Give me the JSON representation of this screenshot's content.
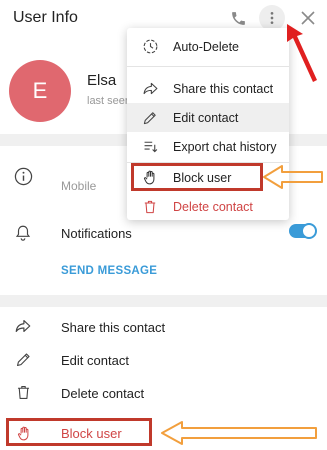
{
  "header": {
    "title": "User Info",
    "icons": [
      "phone-icon",
      "more-vert-icon",
      "close-icon"
    ]
  },
  "profile": {
    "avatar_initial": "E",
    "avatar_color": "#e0686f",
    "name": "Elsa",
    "status": "last seen"
  },
  "info": {
    "mobile_label": "Mobile",
    "notifications_label": "Notifications",
    "notifications_on": true,
    "send_message": "SEND MESSAGE"
  },
  "actions": [
    {
      "label": "Share this contact",
      "icon": "share-icon"
    },
    {
      "label": "Edit contact",
      "icon": "pencil-icon"
    },
    {
      "label": "Delete contact",
      "icon": "trash-icon"
    },
    {
      "label": "Block user",
      "icon": "block-hand-icon"
    }
  ],
  "menu": {
    "items": [
      {
        "label": "Auto-Delete",
        "icon": "timer-icon"
      },
      {
        "label": "Share this contact",
        "icon": "share-icon"
      },
      {
        "label": "Edit contact",
        "icon": "pencil-icon"
      },
      {
        "label": "Export chat history",
        "icon": "export-icon"
      },
      {
        "label": "Block user",
        "icon": "block-hand-icon"
      },
      {
        "label": "Delete contact",
        "icon": "trash-icon"
      }
    ]
  },
  "colors": {
    "accent": "#3a9bd8",
    "danger": "#d04545",
    "highlight": "#c0392b",
    "arrow": "#f29f3d",
    "pointer": "#e02020"
  }
}
